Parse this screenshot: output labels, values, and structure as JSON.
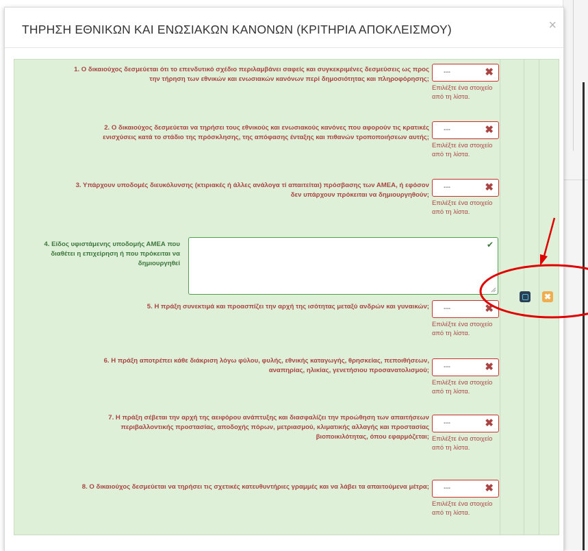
{
  "modal": {
    "title": "ΤΗΡΗΣΗ ΕΘΝΙΚΩΝ ΚΑΙ ΕΝΩΣΙΑΚΩΝ ΚΑΝΟΝΩΝ (ΚΡΙΤΗΡΙΑ ΑΠΟΚΛΕΙΣΜΟΥ)",
    "close": "×"
  },
  "questions": [
    {
      "line1": "1. Ο δικαιούχος δεσμεύεται ότι το επενδυτικό σχέδιο περιλαμβάνει σαφείς και συγκεκριμένες δεσμεύσεις ως προς",
      "line2": "την τήρηση των εθνικών και ενωσιακών κανόνων περί δημοσιότητας και πληροφόρησης;",
      "select_value": "---",
      "help": "Επιλέξτε ένα στοιχείο από τη λίστα."
    },
    {
      "line1": "2. Ο δικαιούχος δεσμεύεται να τηρήσει τους εθνικούς και ενωσιακούς κανόνες που αφορούν τις κρατικές",
      "line2": "ενισχύσεις κατά το στάδιο της πρόσκλησης, της απόφασης ένταξης και πιθανών τροποποιήσεων αυτής;",
      "select_value": "---",
      "help": "Επιλέξτε ένα στοιχείο από τη λίστα."
    },
    {
      "line1": "3. Υπάρχουν υποδομές διευκόλυνσης (κτιριακές ή άλλες ανάλογα τί απαιτείται) πρόσβασης των ΑΜΕΑ, ή εφόσον",
      "line2": "δεν υπάρχουν πρόκειται να δημιουργηθούν;",
      "select_value": "---",
      "help": "Επιλέξτε ένα στοιχείο από τη λίστα."
    },
    {
      "line1": "4. Είδος υφιστάμενης υποδομής ΑΜΕΑ που",
      "line2": "διαθέτει η επιχείρηση ή που πρόκειται να",
      "line3": "δημιουργηθεί",
      "textarea_value": ""
    },
    {
      "line1": "5. Η πράξη συνεκτιμά και προασπίζει την αρχή της ισότητας μεταξύ ανδρών και γυναικών;",
      "select_value": "---",
      "help": "Επιλέξτε ένα στοιχείο από τη λίστα."
    },
    {
      "line1": "6. Η πράξη αποτρέπει κάθε διάκριση λόγω φύλου, φυλής, εθνικής καταγωγής, θρησκείας, πεποιθήσεων,",
      "line2": "αναπηρίας, ηλικίας, γενετήσιου προσανατολισμού;",
      "select_value": "---",
      "help": "Επιλέξτε ένα στοιχείο από τη λίστα."
    },
    {
      "line1": "7. Η πράξη σέβεται την αρχή της αειφόρου ανάπτυξης και διασφαλίζει την προώθηση των απαιτήσεων",
      "line2": "περιβαλλοντικής προστασίας, αποδοχής πόρων, μετριασμού, κλιματικής αλλαγής και προστασίας",
      "line3": "βιοποικιλότητας, όπου εφαρμόζεται;",
      "select_value": "---",
      "help": "Επιλέξτε ένα στοιχείο από τη λίστα."
    },
    {
      "line1": "8. Ο δικαιούχος δεσμεύεται να τηρήσει τις σχετικές κατευθυντήριες γραμμές και να λάβει τα απαιτούμενα μέτρα;",
      "select_value": "---",
      "help": "Επιλέξτε ένα στοιχείο από τη λίστα."
    }
  ],
  "actions": {
    "remove_glyph": "✖",
    "check_glyph": "✔",
    "clear_glyph": "✖"
  },
  "colors": {
    "panel_bg": "#dff0d8",
    "error": "#a94442",
    "success": "#3c763d",
    "annotation": "#e00000"
  }
}
